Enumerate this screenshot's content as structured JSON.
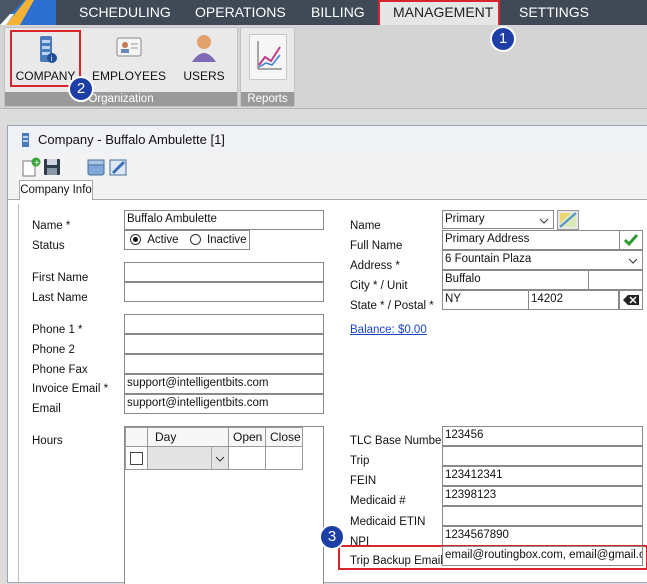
{
  "menu": {
    "items": [
      {
        "label": "SCHEDULING"
      },
      {
        "label": "OPERATIONS"
      },
      {
        "label": "BILLING"
      },
      {
        "label": "MANAGEMENT"
      },
      {
        "label": "SETTINGS"
      }
    ]
  },
  "ribbon": {
    "organization": {
      "label": "Organization",
      "buttons": [
        {
          "label": "COMPANY",
          "icon": "building-icon"
        },
        {
          "label": "EMPLOYEES",
          "icon": "id-card-icon"
        },
        {
          "label": "USERS",
          "icon": "user-icon"
        }
      ]
    },
    "reports": {
      "label": "Reports",
      "icon": "chart-icon"
    }
  },
  "badges": [
    "1",
    "2",
    "3"
  ],
  "window": {
    "title": "Company - Buffalo Ambulette [1]",
    "tab": "Company Info"
  },
  "left": {
    "name_label": "Name *",
    "name_value": "Buffalo Ambulette",
    "status_label": "Status",
    "status_active": "Active",
    "status_inactive": "Inactive",
    "first_name_label": "First Name",
    "last_name_label": "Last Name",
    "phone1_label": "Phone 1 *",
    "phone2_label": "Phone 2",
    "phone_fax_label": "Phone Fax",
    "invoice_email_label": "Invoice Email *",
    "invoice_email_value": "support@intelligentbits.com",
    "email_label": "Email",
    "email_value": "support@intelligentbits.com",
    "hours_label": "Hours",
    "hours_cols": [
      "Day",
      "Open",
      "Close"
    ]
  },
  "right": {
    "name_label": "Name",
    "name_value": "Primary",
    "full_name_label": "Full Name",
    "full_name_value": "Primary Address",
    "address_label": "Address *",
    "address_value": "6 Fountain Plaza",
    "city_label": "City * / Unit",
    "city_value": "Buffalo",
    "state_label": "State * / Postal *",
    "state_value": "NY",
    "postal_value": "14202",
    "balance_link": "Balance: $0.00",
    "tlc_label": "TLC Base Number",
    "tlc_value": "123456",
    "trip_label": "Trip",
    "fein_label": "FEIN",
    "fein_value": "123412341",
    "medicaid_label": "Medicaid #",
    "medicaid_value": "12398123",
    "medicaid_etin_label": "Medicaid ETIN",
    "npi_label": "NPI",
    "npi_value": "1234567890",
    "trip_backup_label": "Trip Backup Email",
    "trip_backup_value": "email@routingbox.com, email@gmail.com"
  },
  "colors": {
    "topbar": "#3f4a56",
    "highlight": "#d9242b",
    "badge": "#1d3ea5",
    "link": "#1a44c8",
    "check": "#2e9a2e"
  }
}
